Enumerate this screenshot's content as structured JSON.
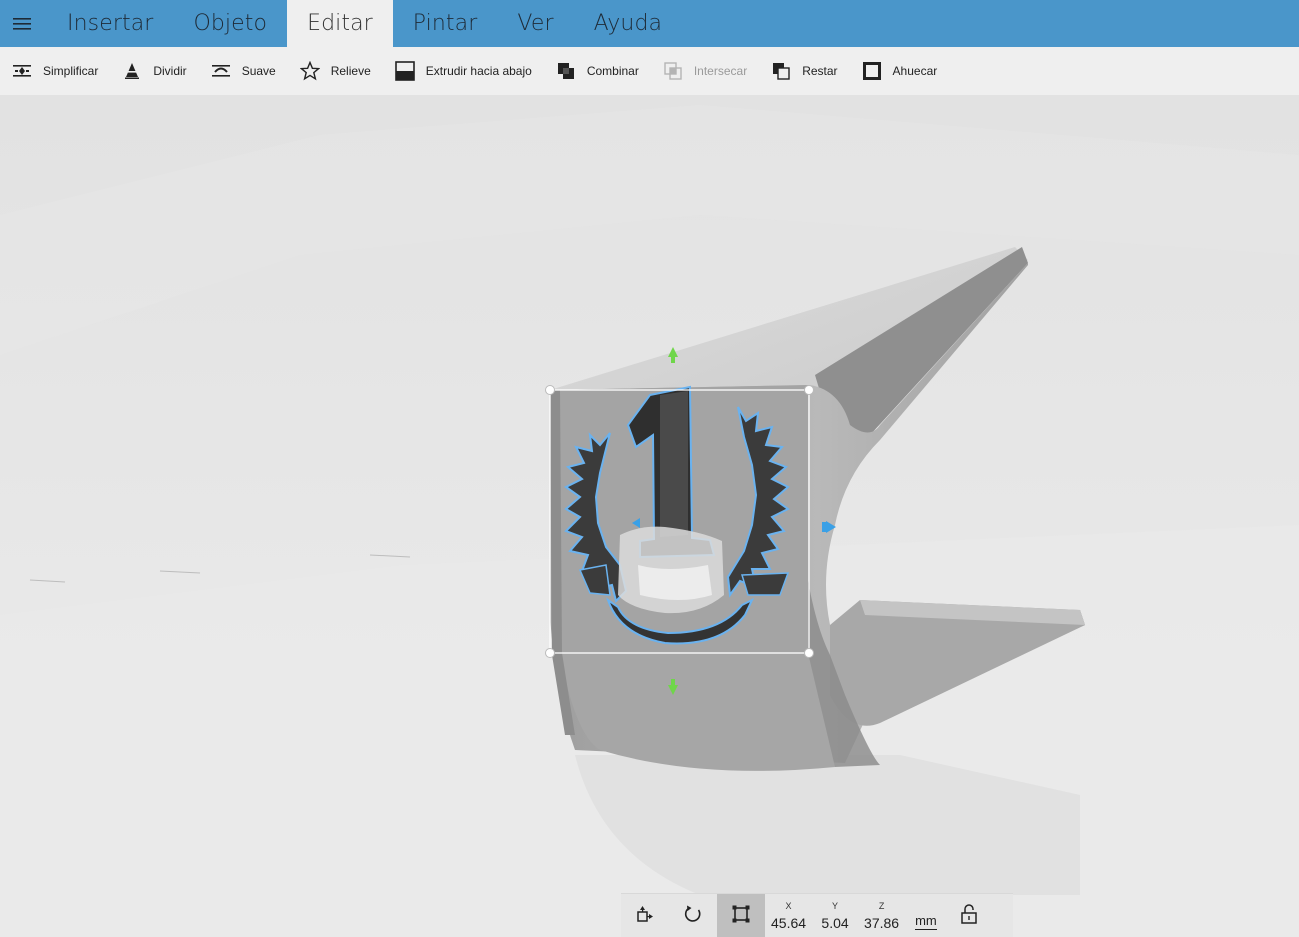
{
  "menubar": {
    "menu_icon": "hamburger-icon",
    "tabs": [
      {
        "label": "Insertar",
        "active": false
      },
      {
        "label": "Objeto",
        "active": false
      },
      {
        "label": "Editar",
        "active": true
      },
      {
        "label": "Pintar",
        "active": false
      },
      {
        "label": "Ver",
        "active": false
      },
      {
        "label": "Ayuda",
        "active": false
      }
    ],
    "accent_color": "#4a96ca"
  },
  "toolbar": {
    "tools": [
      {
        "label": "Simplificar",
        "icon": "simplify-icon",
        "enabled": true
      },
      {
        "label": "Dividir",
        "icon": "split-icon",
        "enabled": true
      },
      {
        "label": "Suave",
        "icon": "smooth-icon",
        "enabled": true
      },
      {
        "label": "Relieve",
        "icon": "star-icon",
        "enabled": true
      },
      {
        "label": "Extrudir hacia abajo",
        "icon": "extrude-down-icon",
        "enabled": true
      },
      {
        "label": "Combinar",
        "icon": "combine-icon",
        "enabled": true
      },
      {
        "label": "Intersecar",
        "icon": "intersect-icon",
        "enabled": false
      },
      {
        "label": "Restar",
        "icon": "subtract-icon",
        "enabled": true
      },
      {
        "label": "Ahuecar",
        "icon": "hollow-icon",
        "enabled": true
      }
    ]
  },
  "transform": {
    "buttons": [
      "move-icon",
      "rotate-icon",
      "scale-icon"
    ],
    "active_button": "scale-icon",
    "x": {
      "label": "X",
      "value": "45.64"
    },
    "y": {
      "label": "Y",
      "value": "5.04"
    },
    "z": {
      "label": "Z",
      "value": "37.86"
    },
    "unit": "mm",
    "lock_icon": "lock-icon"
  },
  "colors": {
    "selection_outline": "#6ab2ef",
    "gizmo_green": "#6fd64a",
    "gizmo_blue": "#3aa0e6",
    "model_gray": "#9a9a9a"
  }
}
